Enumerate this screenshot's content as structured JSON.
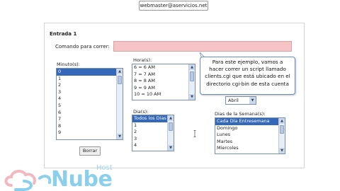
{
  "header": {
    "email": "webmaster@aservicios.net"
  },
  "form": {
    "title": "Entrada 1",
    "command_label": "Comando para correr:",
    "command_value": "",
    "minuto": {
      "label": "Minuto(s):",
      "options": [
        "0",
        "1",
        "2",
        "3",
        "4",
        "5",
        "6",
        "7",
        "8",
        "9"
      ],
      "selected": "0"
    },
    "hora": {
      "label": "Hora(s):",
      "options": [
        "6 = 6 AM",
        "7 = 7 AM",
        "8 = 8 AM",
        "9 = 9 AM",
        "10 = 10 AM"
      ]
    },
    "dia": {
      "label": "Dia(s):",
      "options": [
        "Todos los Dias",
        "1",
        "2",
        "3",
        "4"
      ],
      "selected": "Todos los Dias"
    },
    "mes": {
      "selected": "Abril"
    },
    "semana": {
      "label": "Dias de la Semana(s):",
      "options": [
        "Cada Día Entresemana",
        "Domingo",
        "Lunes",
        "Martes",
        "Miercoles"
      ],
      "selected": "Cada Día Entresemana"
    },
    "clear_button": "Borrar"
  },
  "callout": {
    "lines": [
      "Para este ejemplo, vamos a",
      "hacer correr un script llamado",
      "clients.cgi que está ubicado en el",
      "directorio cgi-bin de esta cuenta"
    ]
  },
  "brand": {
    "name": "Nube",
    "suffix": "Host",
    "colors": {
      "primary": "#8ad0ec",
      "cloud": "#f2b8bf"
    }
  }
}
